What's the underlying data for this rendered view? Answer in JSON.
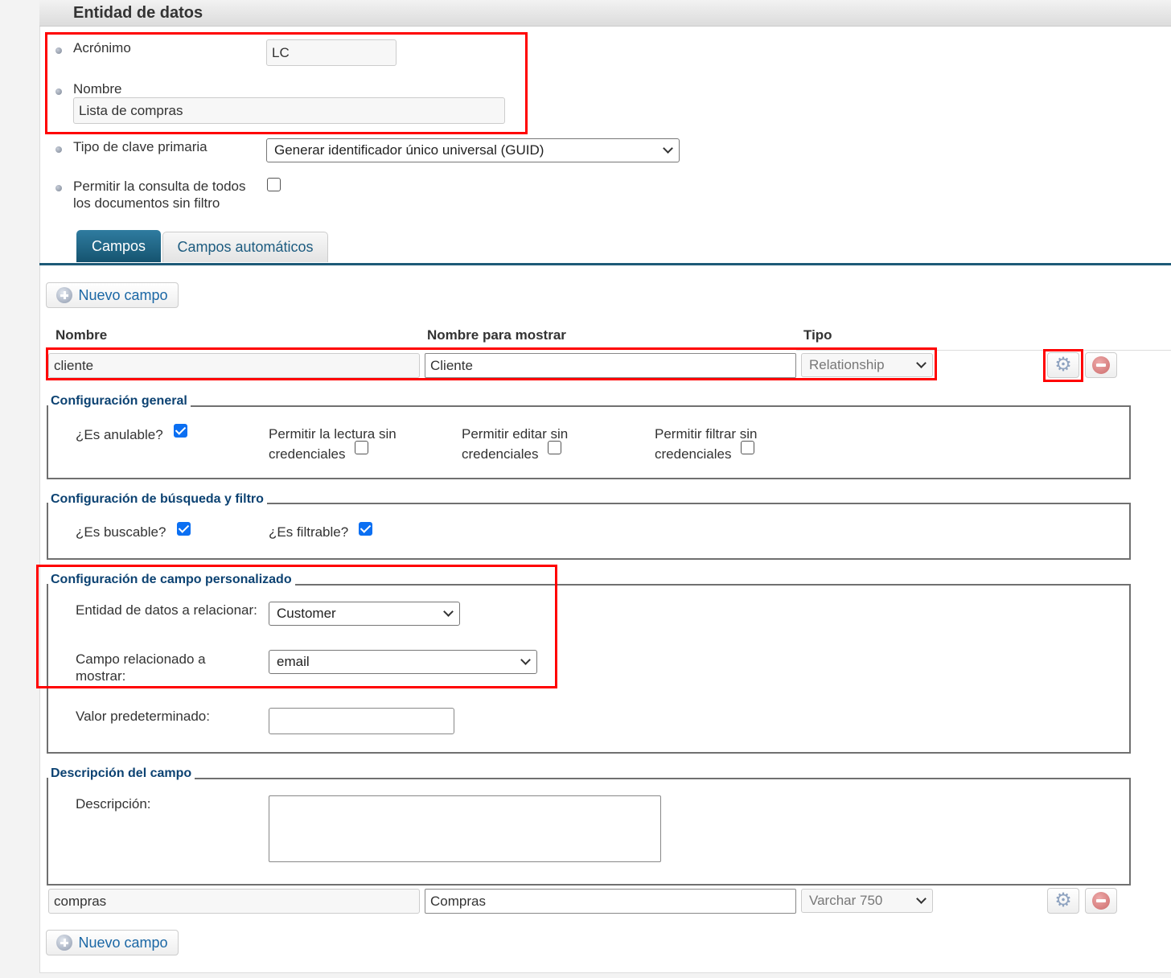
{
  "header": {
    "title": "Entidad de datos"
  },
  "form": {
    "acronym_label": "Acrónimo",
    "acronym_value": "LC",
    "name_label": "Nombre",
    "name_value": "Lista de compras",
    "pk_label": "Tipo de clave primaria",
    "pk_value": "Generar identificador único universal (GUID)",
    "allow_query_label_1": "Permitir la consulta de todos",
    "allow_query_label_2": "los documentos sin filtro",
    "allow_query_checked": false
  },
  "tabs": [
    {
      "label": "Campos",
      "active": true
    },
    {
      "label": "Campos automáticos",
      "active": false
    }
  ],
  "new_field_label": "Nuevo campo",
  "columns": {
    "name": "Nombre",
    "display": "Nombre para mostrar",
    "type": "Tipo"
  },
  "fields": [
    {
      "name": "cliente",
      "display": "Cliente",
      "type": "Relationship"
    },
    {
      "name": "compras",
      "display": "Compras",
      "type": "Varchar 750"
    }
  ],
  "config_general": {
    "legend": "Configuración general",
    "nullable": "¿Es anulable?",
    "nullable_checked": true,
    "read_1": "Permitir la lectura sin",
    "read_2": "credenciales",
    "read_checked": false,
    "edit_1": "Permitir editar sin",
    "edit_2": "credenciales",
    "edit_checked": false,
    "filter_1": "Permitir filtrar sin",
    "filter_2": "credenciales",
    "filter_checked": false
  },
  "config_search": {
    "legend": "Configuración de búsqueda y filtro",
    "searchable": "¿Es buscable?",
    "searchable_checked": true,
    "filterable": "¿Es filtrable?",
    "filterable_checked": true
  },
  "config_custom": {
    "legend": "Configuración de campo personalizado",
    "entity_label": "Entidad de datos a relacionar:",
    "entity_value": "Customer",
    "related_label_1": "Campo relacionado a",
    "related_label_2": "mostrar:",
    "related_value": "email",
    "default_label": "Valor predeterminado:",
    "default_value": ""
  },
  "description": {
    "legend": "Descripción del campo",
    "label": "Descripción:",
    "value": ""
  },
  "colors": {
    "tab_active": "#1d6283",
    "legend": "#0c4272",
    "link": "#1b67a5",
    "highlight": "#ff0000"
  }
}
